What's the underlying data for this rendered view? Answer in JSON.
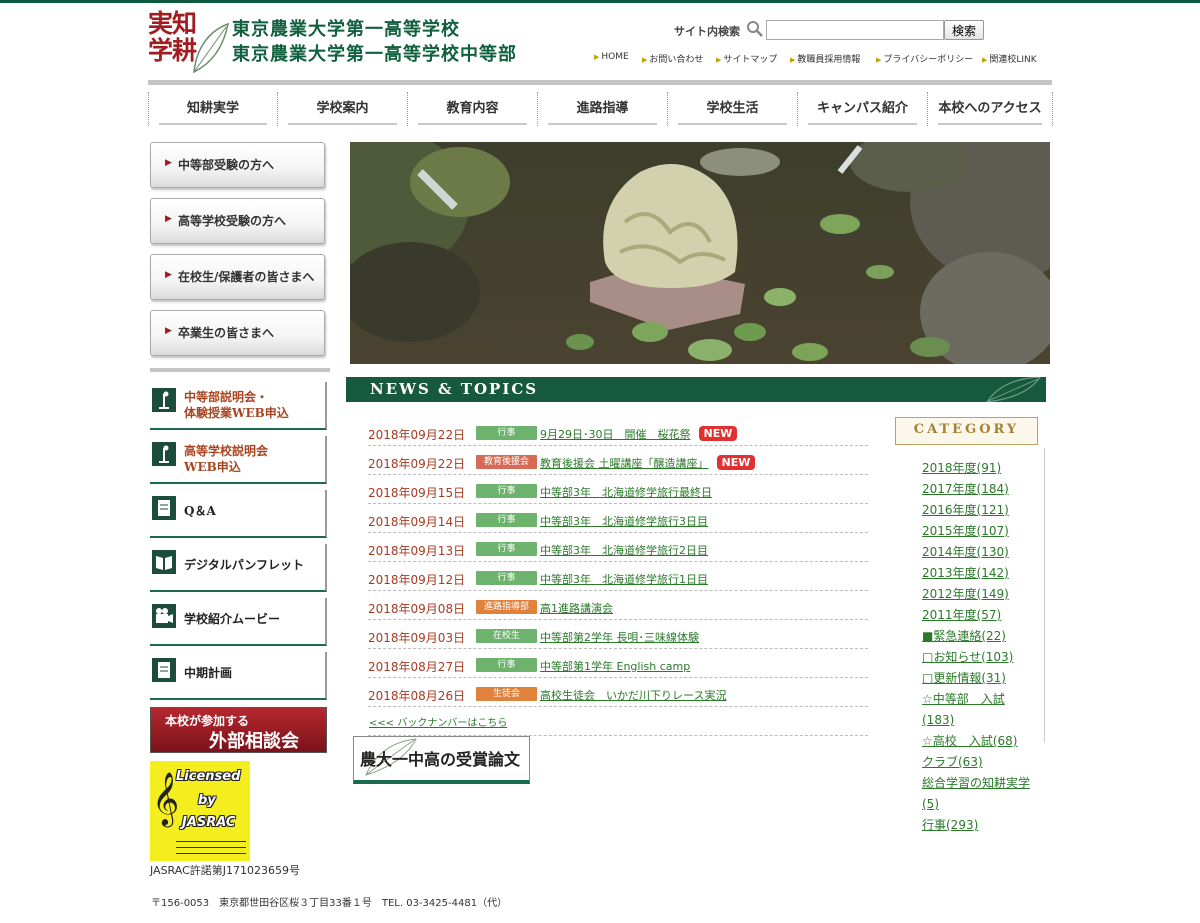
{
  "header": {
    "logo_chars": [
      "実",
      "知",
      "学",
      "耕"
    ],
    "school_name_1": "東京農業大学第一高等学校",
    "school_name_2": "東京農業大学第一高等学校中等部",
    "search_label": "サイト内検索",
    "search_placeholder": "",
    "search_button": "検索",
    "util_links": [
      "HOME",
      "お問い合わせ",
      "サイトマップ",
      "教職員採用情報",
      "プライバシーポリシー",
      "関連校LINK"
    ]
  },
  "gnav": [
    "知耕実学",
    "学校案内",
    "教育内容",
    "進路指導",
    "学校生活",
    "キャンパス紹介",
    "本校へのアクセス"
  ],
  "side_buttons": [
    "中等部受験の方へ",
    "高等学校受験の方へ",
    "在校生/保護者の皆さまへ",
    "卒業生の皆さまへ"
  ],
  "side_links": [
    {
      "line1": "中等部説明会・",
      "line2": "体験授業WEB申込",
      "icon": "podium-icon"
    },
    {
      "line1": "高等学校説明会",
      "line2": "WEB申込",
      "icon": "podium-icon"
    },
    {
      "line1": "Q＆A",
      "icon": "document-icon"
    },
    {
      "line1": "デジタルパンフレット",
      "icon": "book-icon"
    },
    {
      "line1": "学校紹介ムービー",
      "icon": "camera-icon"
    },
    {
      "line1": "中期計画",
      "icon": "document-icon"
    }
  ],
  "outside_consult": {
    "line1": "本校が参加する",
    "line2": "外部相談会"
  },
  "jasrac": {
    "line1": "Licensed",
    "line2": "by",
    "line3": "JASRAC",
    "number": "JASRAC許諾第J171023659号"
  },
  "news": {
    "heading": "NEWS & TOPICS",
    "items": [
      {
        "date": "2018年09月22日",
        "tag": "行事",
        "tag_color": "#6db36d",
        "title": "9月29日･30日　開催　桜花祭",
        "new": "NEW"
      },
      {
        "date": "2018年09月22日",
        "tag": "教育後援会",
        "tag_color": "#d76a55",
        "title": "教育後援会 土曜講座「醸造講座」",
        "new": "NEW"
      },
      {
        "date": "2018年09月15日",
        "tag": "行事",
        "tag_color": "#6db36d",
        "title": "中等部3年　北海道修学旅行最終日",
        "new": ""
      },
      {
        "date": "2018年09月14日",
        "tag": "行事",
        "tag_color": "#6db36d",
        "title": "中等部3年　北海道修学旅行3日目",
        "new": ""
      },
      {
        "date": "2018年09月13日",
        "tag": "行事",
        "tag_color": "#6db36d",
        "title": "中等部3年　北海道修学旅行2日目",
        "new": ""
      },
      {
        "date": "2018年09月12日",
        "tag": "行事",
        "tag_color": "#6db36d",
        "title": "中等部3年　北海道修学旅行1日目",
        "new": ""
      },
      {
        "date": "2018年09月08日",
        "tag": "進路指導部",
        "tag_color": "#e0813c",
        "title": "高1進路講演会",
        "new": ""
      },
      {
        "date": "2018年09月03日",
        "tag": "在校生",
        "tag_color": "#6db36d",
        "title": "中等部第2学年 長唄･三味線体験",
        "new": ""
      },
      {
        "date": "2018年08月27日",
        "tag": "行事",
        "tag_color": "#6db36d",
        "title": "中等部第1学年 English camp",
        "new": ""
      },
      {
        "date": "2018年08月26日",
        "tag": "生徒会",
        "tag_color": "#e0813c",
        "title": "高校生徒会　いかだ川下りレース実況",
        "new": ""
      }
    ],
    "back_number": "<<< バックナンバーはこちら"
  },
  "award_banner": "農大一中高の受賞論文",
  "category": {
    "heading": "CATEGORY",
    "items": [
      "2018年度(91)",
      "2017年度(184)",
      "2016年度(121)",
      "2015年度(107)",
      "2014年度(130)",
      "2013年度(142)",
      "2012年度(149)",
      "2011年度(57)",
      "■緊急連絡(22)",
      "□お知らせ(103)",
      "□更新情報(31)",
      "☆中等部　入試",
      "(183)",
      "☆高校　入試(68)",
      "クラブ(63)",
      "総合学習の知耕実学",
      "(5)",
      "行事(293)"
    ]
  },
  "footer": "〒156-0053　東京都世田谷区桜３丁目33番１号　TEL. 03-3425-4481（代）",
  "colors": {
    "brand_green": "#0f5a3f",
    "accent_red": "#a11d21",
    "link_green": "#2a7a2a"
  }
}
